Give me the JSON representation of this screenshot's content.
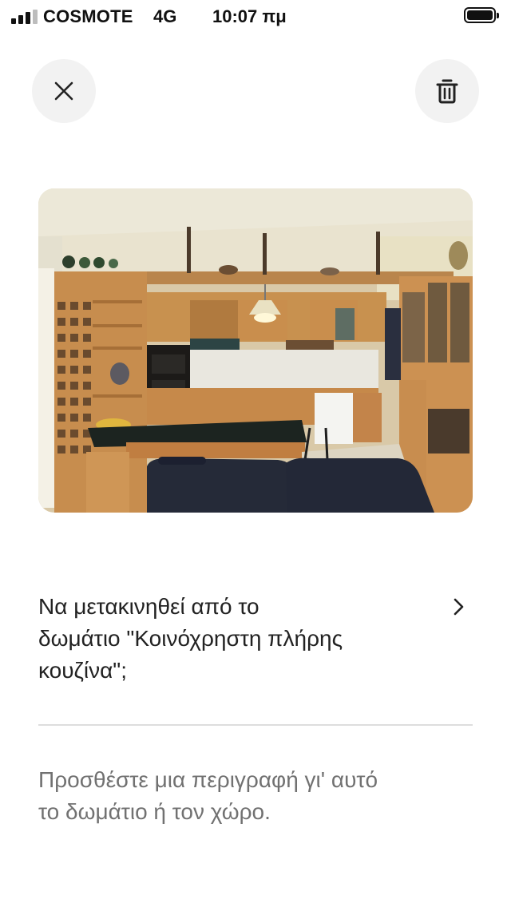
{
  "status_bar": {
    "carrier": "COSMOTE",
    "network": "4G",
    "time": "10:07 πμ",
    "signal_bars_filled": 3,
    "signal_bars_total": 4,
    "battery_level": 1.0
  },
  "toolbar": {
    "close_icon": "close-icon",
    "delete_icon": "trash-icon"
  },
  "photo": {
    "subject": "kitchen"
  },
  "move_prompt": {
    "text": "Να μετακινηθεί από το\nδωμάτιο \"Κοινόχρηστη πλήρης\nκουζίνα\";",
    "icon": "chevron-right-icon"
  },
  "description": {
    "placeholder": "Προσθέστε μια περιγραφή γι' αυτό\nτο δωμάτιο ή τον χώρο."
  },
  "colors": {
    "button_bg": "#f2f2f2",
    "text_primary": "#222222",
    "text_secondary": "#717171",
    "divider": "#dddddd"
  }
}
